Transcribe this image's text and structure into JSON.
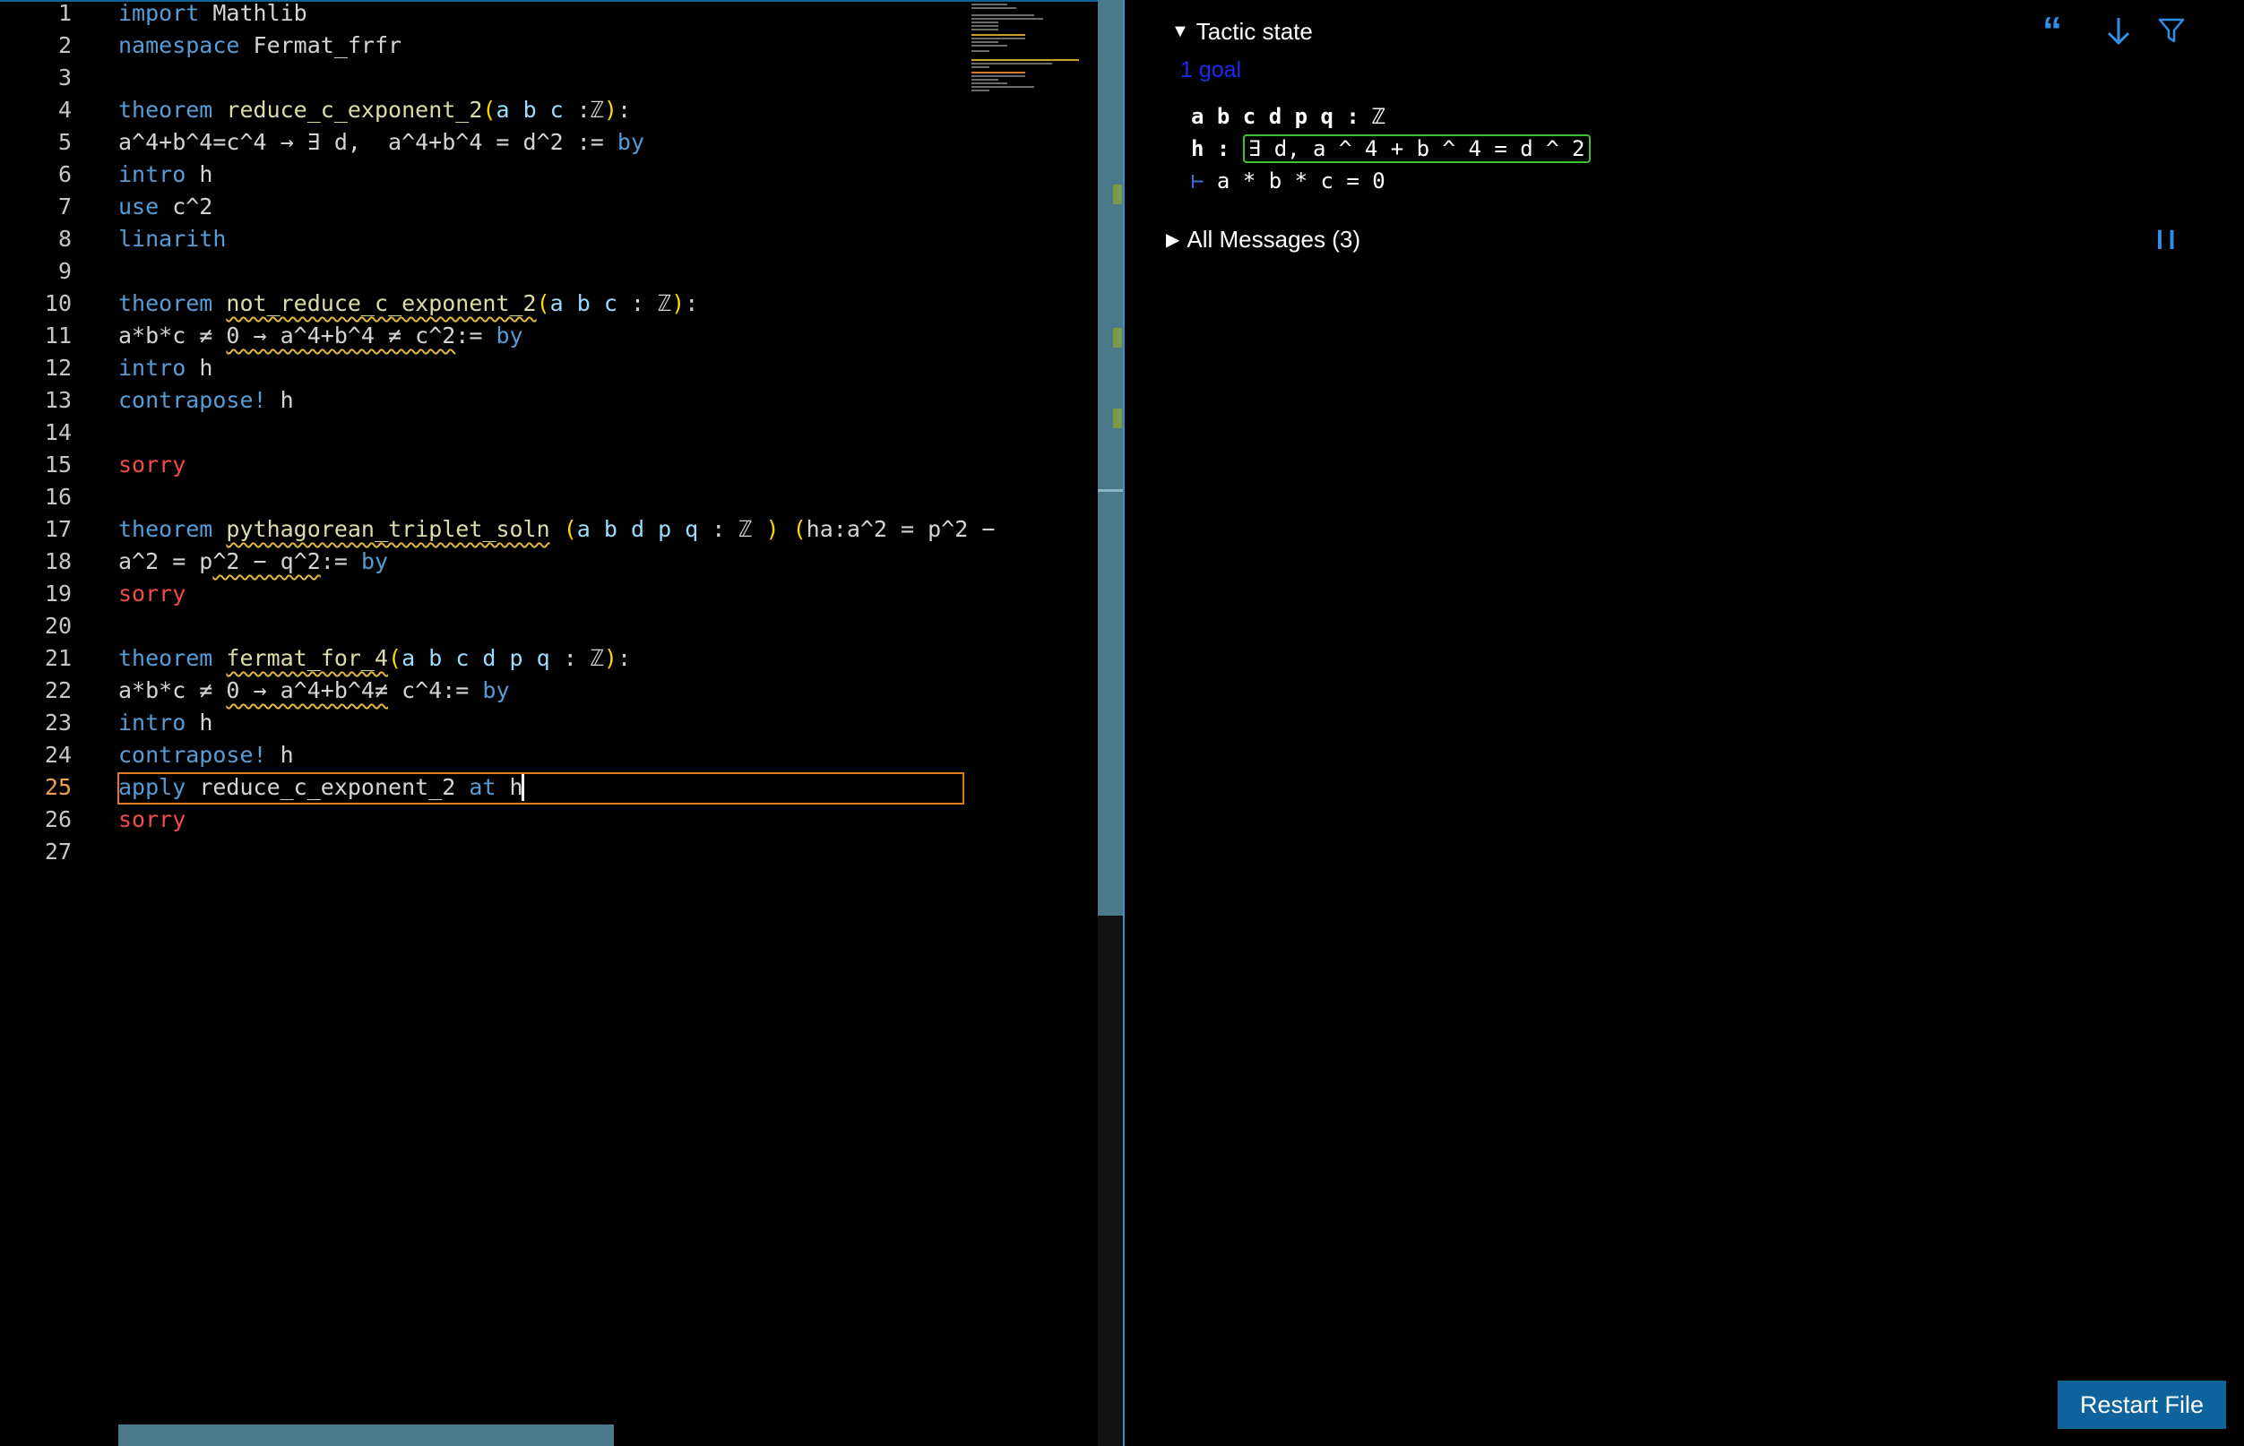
{
  "editor": {
    "active_line": 25,
    "line_numbers": [
      "1",
      "2",
      "3",
      "4",
      "5",
      "6",
      "7",
      "8",
      "9",
      "10",
      "11",
      "12",
      "13",
      "14",
      "15",
      "16",
      "17",
      "18",
      "19",
      "20",
      "21",
      "22",
      "23",
      "24",
      "25",
      "26",
      "27"
    ],
    "code_lines": [
      [
        {
          "t": "import",
          "c": "kw"
        },
        {
          "t": " Mathlib",
          "c": "op"
        }
      ],
      [
        {
          "t": "namespace",
          "c": "kw"
        },
        {
          "t": " Fermat_frfr",
          "c": "op"
        }
      ],
      [],
      [
        {
          "t": "theorem",
          "c": "kw"
        },
        {
          "t": " ",
          "c": "op"
        },
        {
          "t": "reduce_c_exponent_2",
          "c": "fn"
        },
        {
          "t": "(",
          "c": "par"
        },
        {
          "t": "a b c ",
          "c": "var"
        },
        {
          "t": ":ℤ",
          "c": "op"
        },
        {
          "t": ")",
          "c": "par"
        },
        {
          "t": ":",
          "c": "op"
        }
      ],
      [
        {
          "t": "a^4+b^4=c^4 → ∃ d,  a^4+b^4 = d^2 := ",
          "c": "op"
        },
        {
          "t": "by",
          "c": "kw"
        }
      ],
      [
        {
          "t": "intro",
          "c": "kw"
        },
        {
          "t": " h",
          "c": "op"
        }
      ],
      [
        {
          "t": "use",
          "c": "kw"
        },
        {
          "t": " c^2",
          "c": "op"
        }
      ],
      [
        {
          "t": "linarith",
          "c": "kw"
        }
      ],
      [],
      [
        {
          "t": "theorem",
          "c": "kw"
        },
        {
          "t": " ",
          "c": "op"
        },
        {
          "t": "not_reduce_c_exponent_2",
          "c": "fn sq"
        },
        {
          "t": "(",
          "c": "par"
        },
        {
          "t": "a b c ",
          "c": "var"
        },
        {
          "t": ": ℤ",
          "c": "op"
        },
        {
          "t": ")",
          "c": "par"
        },
        {
          "t": ":",
          "c": "op"
        }
      ],
      [
        {
          "t": "a*b*c ≠ ",
          "c": "op"
        },
        {
          "t": "0 → a^4+b^4 ≠ c^2",
          "c": "op sq"
        },
        {
          "t": ":= ",
          "c": "op"
        },
        {
          "t": "by",
          "c": "kw"
        }
      ],
      [
        {
          "t": "intro",
          "c": "kw"
        },
        {
          "t": " h",
          "c": "op"
        }
      ],
      [
        {
          "t": "contrapose!",
          "c": "kw"
        },
        {
          "t": " h",
          "c": "op"
        }
      ],
      [],
      [
        {
          "t": "sorry",
          "c": "err"
        }
      ],
      [],
      [
        {
          "t": "theorem",
          "c": "kw"
        },
        {
          "t": " ",
          "c": "op"
        },
        {
          "t": "pythagorean_triplet_soln",
          "c": "fn sq"
        },
        {
          "t": " (",
          "c": "par"
        },
        {
          "t": "a b d p q ",
          "c": "var"
        },
        {
          "t": ": ℤ ",
          "c": "op"
        },
        {
          "t": ")",
          "c": "par"
        },
        {
          "t": " (",
          "c": "par"
        },
        {
          "t": "ha:a^2 = p^2 −",
          "c": "op"
        }
      ],
      [
        {
          "t": "a^2 = p",
          "c": "op"
        },
        {
          "t": "^2 − q^2",
          "c": "op sq"
        },
        {
          "t": ":= ",
          "c": "op"
        },
        {
          "t": "by",
          "c": "kw"
        }
      ],
      [
        {
          "t": "sorry",
          "c": "err"
        }
      ],
      [],
      [
        {
          "t": "theorem",
          "c": "kw"
        },
        {
          "t": " ",
          "c": "op"
        },
        {
          "t": "fermat_for_4",
          "c": "fn sq"
        },
        {
          "t": "(",
          "c": "par"
        },
        {
          "t": "a b c d p q ",
          "c": "var"
        },
        {
          "t": ": ℤ",
          "c": "op"
        },
        {
          "t": ")",
          "c": "par"
        },
        {
          "t": ":",
          "c": "op"
        }
      ],
      [
        {
          "t": "a*b*c ≠ ",
          "c": "op"
        },
        {
          "t": "0 → a^4+b^4≠",
          "c": "op sq"
        },
        {
          "t": " c^4:= ",
          "c": "op"
        },
        {
          "t": "by",
          "c": "kw"
        }
      ],
      [
        {
          "t": "intro",
          "c": "kw"
        },
        {
          "t": " h",
          "c": "op"
        }
      ],
      [
        {
          "t": "contrapose!",
          "c": "kw"
        },
        {
          "t": " h",
          "c": "op"
        }
      ],
      [
        {
          "t": "apply",
          "c": "kw"
        },
        {
          "t": " reduce_c_exponent_2 ",
          "c": "op"
        },
        {
          "t": "at",
          "c": "kw"
        },
        {
          "t": " h",
          "c": "op"
        }
      ],
      [
        {
          "t": "sorry",
          "c": "err"
        }
      ],
      []
    ]
  },
  "infoview": {
    "tactic_state_label": "Tactic state",
    "goal_count": "1 goal",
    "hyp_vars": "a b c d p q",
    "hyp_vars_type": ": ℤ",
    "hyp_h_name": "h",
    "hyp_h_colon": ":",
    "hyp_h_expr": "∃ d, a ^ 4 + b ^ 4 = d ^ 2",
    "turnstile": "⊢",
    "goal_expr": "a * b * c = 0",
    "all_messages_label": "All Messages (3)",
    "icons": [
      "quote-icon",
      "arrow-down-icon",
      "filter-icon",
      "pause-icon"
    ],
    "restart_button": "Restart File"
  },
  "colors": {
    "keyword": "#569cd6",
    "function": "#dcdcaa",
    "error": "#f14c4c",
    "accent": "#0e639c",
    "active_line": "#e0791b"
  }
}
